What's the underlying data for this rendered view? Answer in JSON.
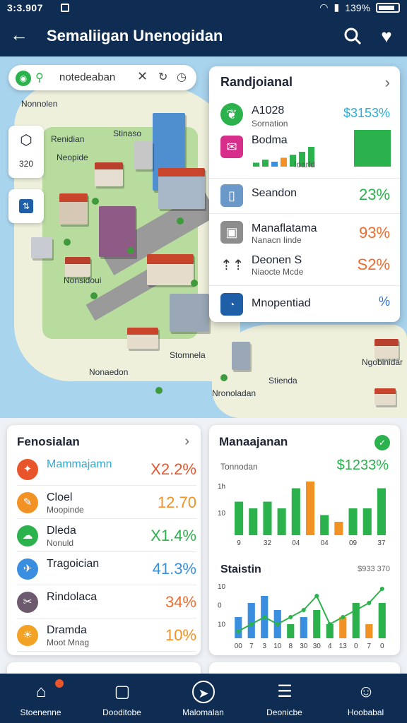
{
  "status": {
    "time": "3:3.907",
    "battery": "139%"
  },
  "header": {
    "title": "Semaliigan Unenogidan"
  },
  "map": {
    "search_text": "notedeaban",
    "labels": [
      "Nonnolen",
      "Renidian",
      "Stinaso",
      "Neopide",
      "Nonsidoui",
      "Stomnela",
      "Nonaedon",
      "Stienda",
      "Nronoladan",
      "Ngobinidar"
    ],
    "tool_value": "320"
  },
  "overlay": {
    "title": "Randjoianal",
    "rows": [
      {
        "icon": "leaf-icon",
        "label": "A1028",
        "sub": "Sornation",
        "value": "$3153%",
        "color": "#2aaed9"
      },
      {
        "icon": "mail-icon",
        "label": "Bodma",
        "sub": "Ioarld",
        "value": "",
        "color": "#2bb24c",
        "bars": [
          8,
          14,
          10,
          18,
          24,
          30,
          40
        ],
        "bar_colors": [
          "#2bb24c",
          "#2bb24c",
          "#3a8ee0",
          "#f29224",
          "#2bb24c",
          "#2bb24c",
          "#2bb24c"
        ]
      },
      {
        "icon": "book-icon",
        "label": "Seandon",
        "sub": "",
        "value": "23%",
        "color": "#2bb24c"
      },
      {
        "icon": "box-icon",
        "label": "Manaflatama",
        "sub": "Nanacn Iinde",
        "value": "93%",
        "color": "#f26b2b"
      },
      {
        "icon": "people-icon",
        "label": "Deonen S",
        "sub": "Niaocte Mcde",
        "value": "S2%",
        "color": "#f26b2b"
      },
      {
        "icon": "gauge-icon",
        "label": "Mnopentiad",
        "sub": "",
        "value": "%",
        "color": "#2f6fd6"
      }
    ]
  },
  "left_card": {
    "title": "Fenosialan",
    "rows": [
      {
        "icon": "shirt-icon",
        "label": "Mammajamn",
        "sub": "",
        "value": "X2.2%",
        "icon_color": "#e8552b",
        "val_color": "#e8552b",
        "label_color": "#2aaed9"
      },
      {
        "icon": "pencil-icon",
        "label": "Cloel",
        "sub": "Moopinde",
        "value": "12.70",
        "icon_color": "#f29224",
        "val_color": "#f29224",
        "label_color": "#1d2433"
      },
      {
        "icon": "cloud-icon",
        "label": "Dleda",
        "sub": "Nonuld",
        "value": "X1.4%",
        "icon_color": "#2bb24c",
        "val_color": "#2bb24c",
        "label_color": "#1d2433"
      },
      {
        "icon": "transit-icon",
        "label": "Tragoician",
        "sub": "",
        "value": "41.3%",
        "icon_color": "#3a8ee0",
        "val_color": "#3a8ee0",
        "label_color": "#1d2433"
      },
      {
        "icon": "scissors-icon",
        "label": "Rindolaca",
        "sub": "",
        "value": "34%",
        "icon_color": "#6d5a6f",
        "val_color": "#f26b2b",
        "label_color": "#1d2433"
      },
      {
        "icon": "sun-icon",
        "label": "Dramda",
        "sub": "Moot Mnag",
        "value": "10%",
        "icon_color": "#f2a224",
        "val_color": "#f29224",
        "label_color": "#1d2433"
      }
    ]
  },
  "right_card": {
    "title": "Manaajanan",
    "subtitle": "Tonnodan",
    "value": "$1233%",
    "stats_title": "Staistin",
    "stats_value": "$933 370"
  },
  "chart_data": [
    {
      "type": "bar",
      "categories": [
        "9",
        "",
        "32",
        "",
        "04",
        "",
        "04",
        "",
        "09",
        "",
        "37"
      ],
      "values": [
        5,
        4,
        5,
        4,
        7,
        8,
        3,
        2,
        4,
        4,
        7
      ],
      "colors": [
        "#2bb24c",
        "#2bb24c",
        "#2bb24c",
        "#2bb24c",
        "#2bb24c",
        "#f29224",
        "#2bb24c",
        "#f29224",
        "#2bb24c",
        "#2bb24c",
        "#2bb24c"
      ],
      "title": "",
      "ylim": [
        0,
        8
      ],
      "yticks": [
        "1h",
        "10"
      ]
    },
    {
      "type": "bar",
      "title": "Staistin",
      "categories": [
        "00",
        "7",
        "3",
        "10",
        "8",
        "30",
        "30",
        "4",
        "13",
        "0",
        "7",
        "0"
      ],
      "values": [
        3,
        5,
        6,
        4,
        2,
        3,
        4,
        2,
        3,
        5,
        2,
        5
      ],
      "colors": [
        "#3a8ee0",
        "#3a8ee0",
        "#3a8ee0",
        "#3a8ee0",
        "#2bb24c",
        "#3a8ee0",
        "#2bb24c",
        "#2bb24c",
        "#f29224",
        "#2bb24c",
        "#f29224",
        "#2bb24c"
      ],
      "line": [
        1,
        2,
        3,
        2,
        3,
        4,
        6,
        2,
        3,
        4,
        5,
        7
      ],
      "ylim": [
        0,
        8
      ],
      "yticks": [
        "10",
        "0",
        "10"
      ]
    }
  ],
  "nav": [
    {
      "label": "Stoenenne",
      "icon": "home-icon"
    },
    {
      "label": "Dooditobe",
      "icon": "calendar-icon"
    },
    {
      "label": "Malomalan",
      "icon": "compass-icon"
    },
    {
      "label": "Deonicbe",
      "icon": "list-icon"
    },
    {
      "label": "Hoobabal",
      "icon": "user-icon"
    }
  ]
}
